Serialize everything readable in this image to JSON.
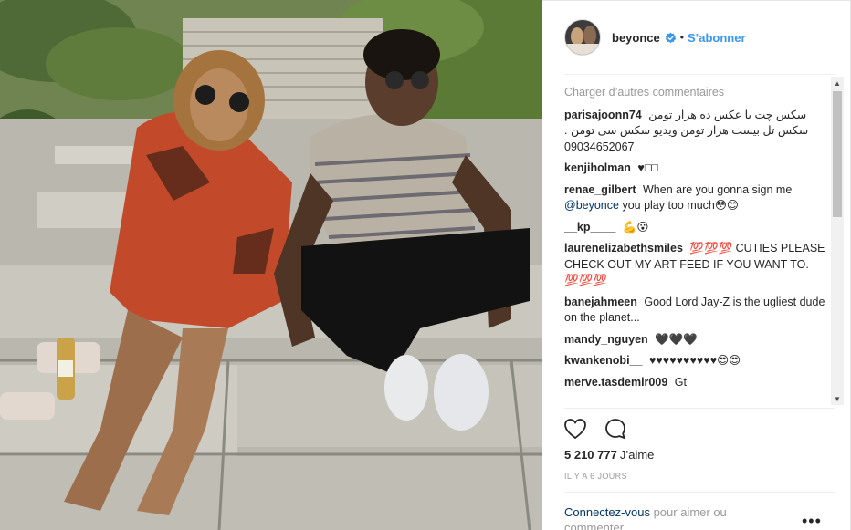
{
  "post": {
    "username": "beyonce",
    "follow_label": "S’abonner",
    "separator": "•",
    "load_more": "Charger d’autres commentaires",
    "comments": [
      {
        "user": "parisajoonn74",
        "text": "سکس چت با عکس ده هزار تومن",
        "text2": "سکس تل بیست هزار تومن ویدیو سکس سی تومن .",
        "text3": "09034652067"
      },
      {
        "user": "kenjiholman",
        "text": "♥□□"
      },
      {
        "user": "renae_gilbert",
        "text": "When are you gonna sign me",
        "mention": "@beyonce",
        "text_after": "you play too much😳😊"
      },
      {
        "user": "__kp____",
        "text": "💪😮"
      },
      {
        "user": "laurenelizabethsmiles",
        "text": "💯💯💯 CUTIES PLEASE CHECK OUT MY ART FEED IF YOU WANT TO. 💯💯💯"
      },
      {
        "user": "banejahmeen",
        "text": "Good Lord Jay-Z is the ugliest dude on the planet..."
      },
      {
        "user": "mandy_nguyen",
        "text": "🖤🖤🖤"
      },
      {
        "user": "kwankenobi__",
        "text": "♥♥♥♥♥♥♥♥♥♥😍😍"
      },
      {
        "user": "merve.tasdemir009",
        "text": "Gt"
      }
    ],
    "likes_count": "5 210 777",
    "likes_label": "J’aime",
    "timestamp": "IL Y A 6 JOURS",
    "login_link": "Connectez-vous",
    "login_rest": "pour aimer ou commenter.",
    "more_options": "•••"
  },
  "icons": {
    "verified": "verified-badge-icon",
    "like": "heart-outline-icon",
    "comment": "comment-bubble-icon",
    "more": "more-options-icon",
    "scroll_up": "scroll-up-arrow",
    "scroll_down": "scroll-down-arrow"
  },
  "colors": {
    "accent": "#3897f0",
    "text": "#262626",
    "muted": "#999999",
    "link": "#003569"
  }
}
